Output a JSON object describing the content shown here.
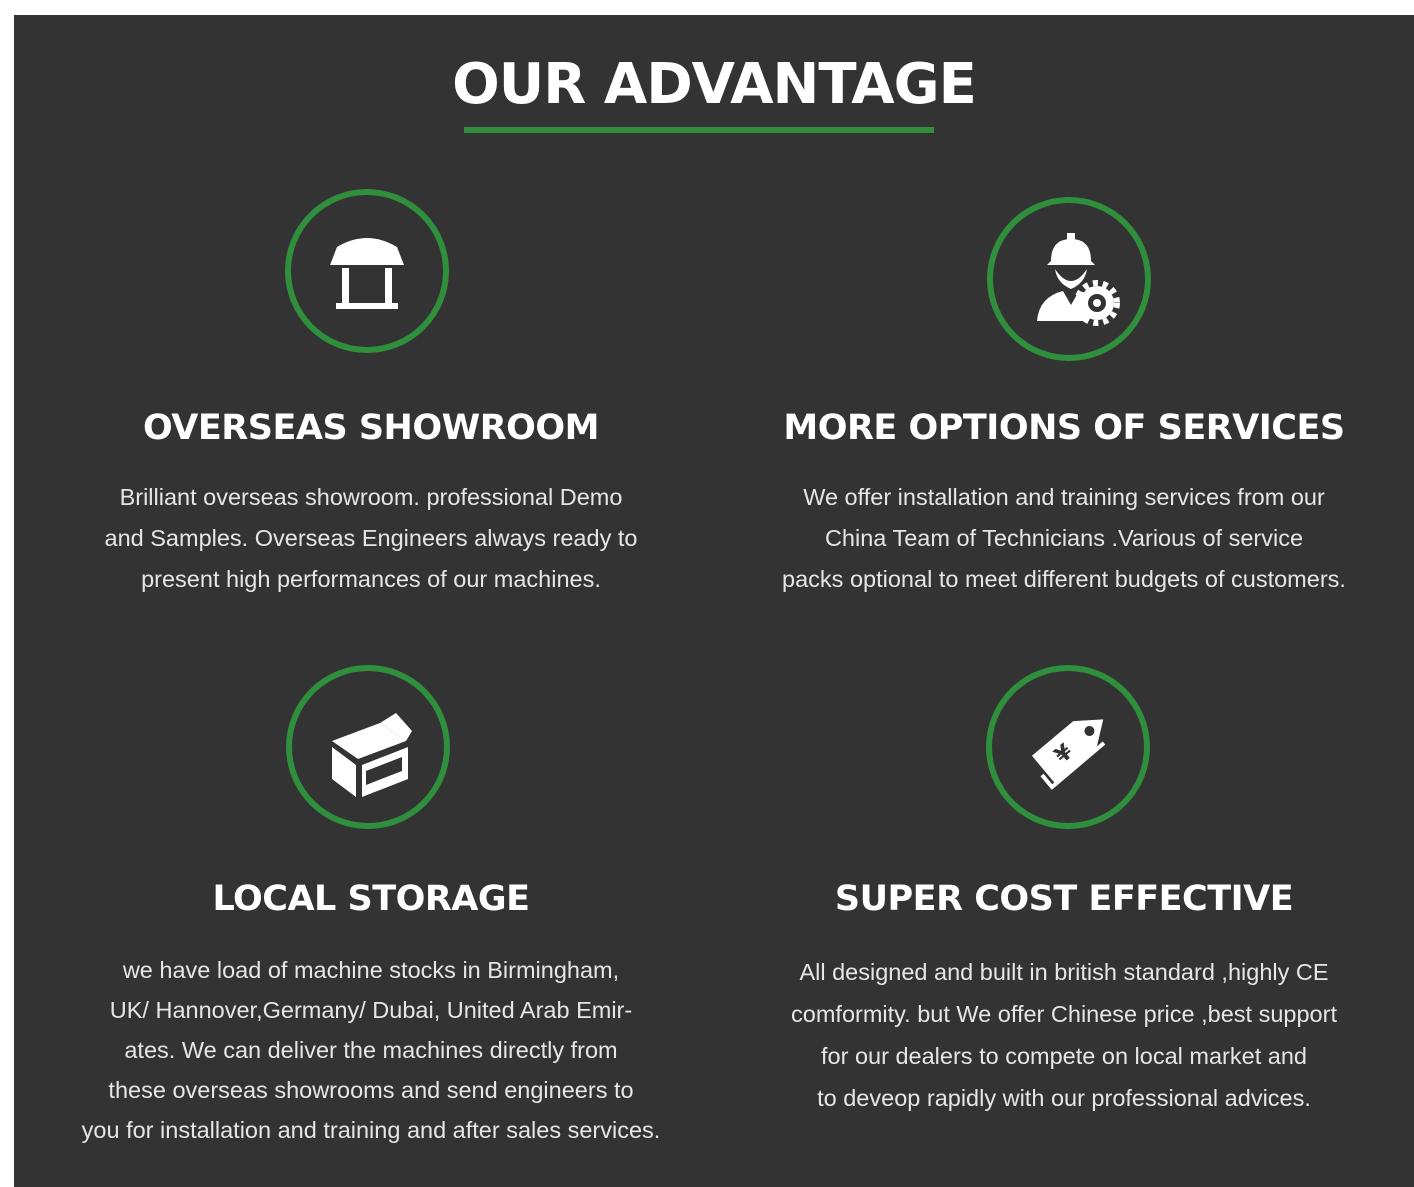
{
  "title": "OUR ADVANTAGE",
  "colors": {
    "background": "#333333",
    "accent_green": "#2f8f3c",
    "text": "#ffffff"
  },
  "features": [
    {
      "icon": "showroom-icon",
      "heading": "OVERSEAS SHOWROOM",
      "lines": [
        "Brilliant overseas showroom. professional Demo",
        "and Samples. Overseas Engineers always ready to",
        "present high performances of our machines."
      ]
    },
    {
      "icon": "engineer-gear-icon",
      "heading": "MORE OPTIONS OF SERVICES",
      "lines": [
        "We offer installation and training services from our",
        "China Team of Technicians .Various of service",
        "packs optional to meet different budgets of customers."
      ]
    },
    {
      "icon": "box-icon",
      "heading": "LOCAL STORAGE",
      "lines": [
        "we have load of machine stocks in Birmingham,",
        "UK/ Hannover,Germany/ Dubai, United Arab Emir-",
        "ates. We can deliver the machines directly from",
        "these overseas showrooms and send engineers to",
        "you for installation and training and after sales services."
      ]
    },
    {
      "icon": "price-tag-icon",
      "heading": "SUPER COST EFFECTIVE",
      "lines": [
        "All designed and built in british standard ,highly CE",
        "comformity. but We offer Chinese price ,best support",
        "for our dealers to compete on local market and",
        "to deveop rapidly with our professional advices."
      ]
    }
  ]
}
